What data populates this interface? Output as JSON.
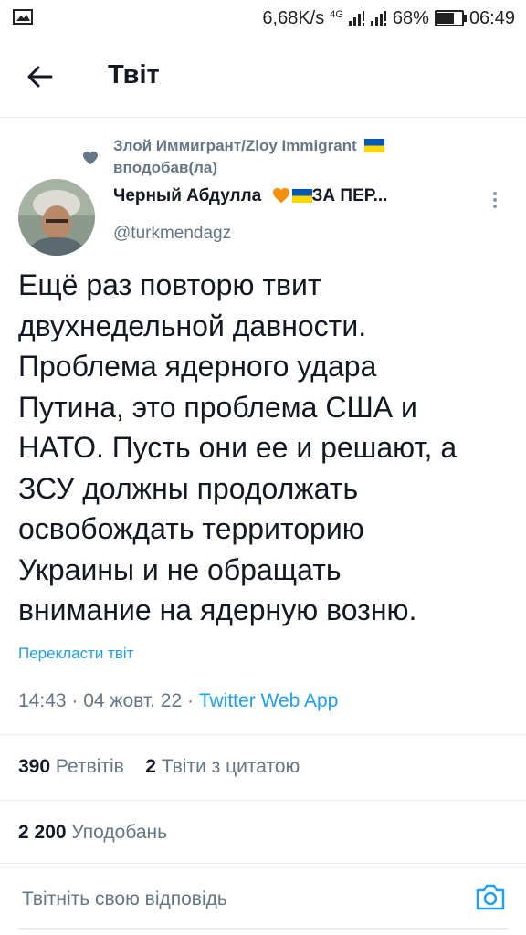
{
  "status_bar": {
    "speed": "6,68K/s",
    "network": "4G",
    "battery_percent": "68%",
    "battery_level": 0.68,
    "time": "06:49"
  },
  "header": {
    "title": "Твіт"
  },
  "social_context": {
    "text": "Злой Иммигрант/Zloy Immigrant",
    "action": "вподобав(ла)"
  },
  "author": {
    "name": "Черный Абдулла",
    "name_suffix": "ЗА ПЕР...",
    "handle": "@turkmendagz"
  },
  "tweet": {
    "text": "Ещё раз повторю твит\nдвухнедельной давности.\nПроблема ядерного удара\nПутина, это проблема США и\nНАТО. Пусть они ее и решают, а\nЗСУ должны продолжать\nосвобождать территорию\nУкраины и не обращать\nвнимание на ядерную возню.",
    "translate_link": "Перекласти твіт",
    "time": "14:43",
    "date": "04 жовт. 22",
    "app": "Twitter Web App"
  },
  "stats": {
    "retweets_count": "390",
    "retweets_label": "Ретвітів",
    "quotes_count": "2",
    "quotes_label": "Твіти з цитатою",
    "likes_count": "2 200",
    "likes_label": "Уподобань"
  },
  "reply": {
    "placeholder": "Твітніть свою відповідь"
  },
  "icons": {
    "back": "arrow-left-icon",
    "more": "more-vertical-icon",
    "camera": "camera-icon",
    "heart": "heart-icon"
  },
  "colors": {
    "accent": "#1da1f2",
    "secondary_text": "#657786",
    "flag_blue": "#0057b7",
    "flag_yellow": "#ffd700",
    "orange_heart": "#f4900c"
  }
}
